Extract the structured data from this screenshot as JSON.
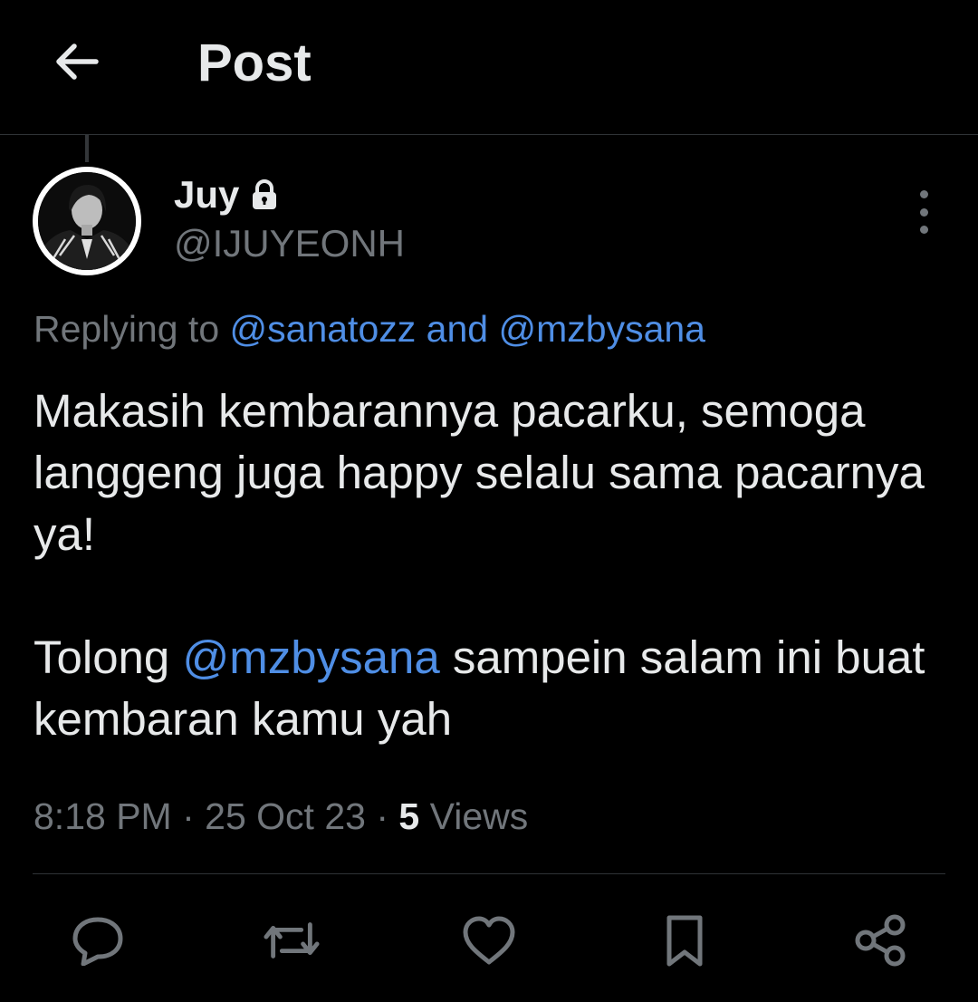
{
  "header": {
    "title": "Post",
    "back_icon": "arrow-left-icon"
  },
  "post": {
    "display_name": "Juy",
    "protected_icon": "lock-icon",
    "handle": "@IJUYEONH",
    "replying_prefix": "Replying to",
    "reply_to_1": "@sanatozz",
    "reply_and": "and",
    "reply_to_2": "@mzbysana",
    "text_para1": "Makasih kembarannya pacarku, semoga langgeng juga happy selalu sama pacarnya ya!",
    "text_para2_prefix": "Tolong",
    "text_para2_mention": "@mzbysana",
    "text_para2_suffix": "sampein salam ini buat kembaran kamu yah",
    "time": "8:18 PM",
    "sep1": "·",
    "date": "25 Oct 23",
    "sep2": "·",
    "views_count": "5",
    "views_label": "Views"
  },
  "actions": {
    "reply_icon": "reply-icon",
    "repost_icon": "repost-icon",
    "like_icon": "heart-icon",
    "bookmark_icon": "bookmark-icon",
    "share_icon": "share-icon"
  },
  "colors": {
    "background": "#000000",
    "text": "#e7e9ea",
    "muted": "#71767b",
    "link": "#4f8ee5",
    "divider": "#2f3336"
  }
}
